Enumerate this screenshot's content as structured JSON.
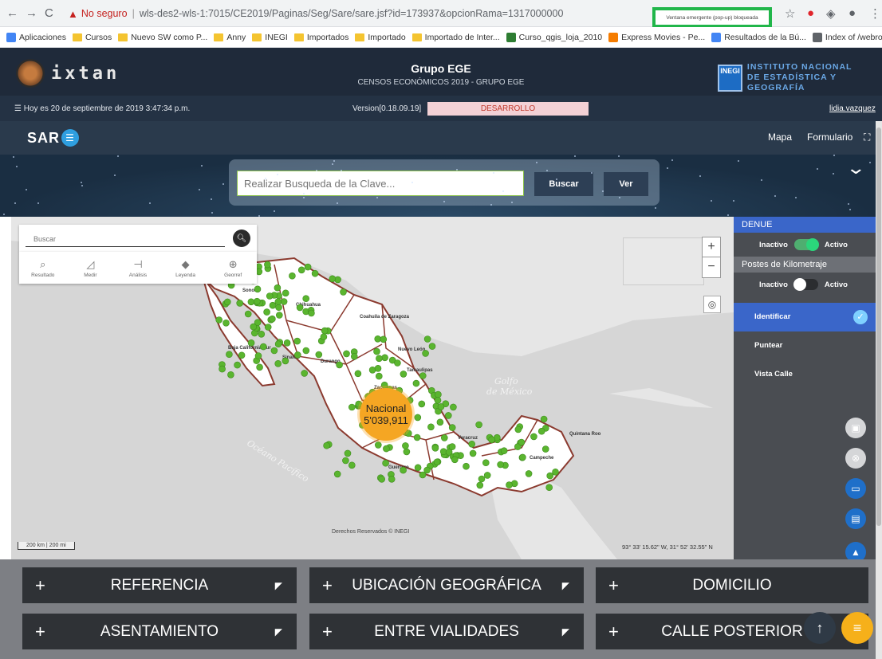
{
  "browser": {
    "security_label": "No seguro",
    "url": "wls-des2-wls-1:7015/CE2019/Paginas/Seg/Sare/sare.jsf?id=173937&opcionRama=1317000000",
    "popup_blocked": "Ventana emergente (pop-up) bloqueada",
    "bookmarks": [
      {
        "label": "Aplicaciones",
        "icon": "apps-grid-icon",
        "color": "#4285f4"
      },
      {
        "label": "Cursos",
        "icon": "folder-icon",
        "color": "#f4c430"
      },
      {
        "label": "Nuevo SW como P...",
        "icon": "folder-icon",
        "color": "#f4c430"
      },
      {
        "label": "Anny",
        "icon": "folder-icon",
        "color": "#f4c430"
      },
      {
        "label": "INEGI",
        "icon": "folder-icon",
        "color": "#f4c430"
      },
      {
        "label": "Importados",
        "icon": "folder-icon",
        "color": "#f4c430"
      },
      {
        "label": "Importado",
        "icon": "folder-icon",
        "color": "#f4c430"
      },
      {
        "label": "Importado de Inter...",
        "icon": "folder-icon",
        "color": "#f4c430"
      },
      {
        "label": "Curso_qgis_loja_2010",
        "icon": "qgis-icon",
        "color": "#2e7d32"
      },
      {
        "label": "Express Movies - Pe...",
        "icon": "blogger-icon",
        "color": "#f57c00"
      },
      {
        "label": "Resultados de la Bú...",
        "icon": "google-icon",
        "color": "#4285f4"
      },
      {
        "label": "Index of /webroot/...",
        "icon": "globe-icon",
        "color": "#5f6368"
      }
    ]
  },
  "header": {
    "logo_text": "ixtan",
    "title": "Grupo EGE",
    "subtitle": "CENSOS ECONÓMICOS 2019 - GRUPO EGE",
    "inegi_badge": "INEGI",
    "inegi_line1": "INSTITUTO NACIONAL",
    "inegi_line2": "DE ESTADÍSTICA Y GEOGRAFÍA",
    "date_text": "Hoy es 20 de septiembre de 2019 3:47:34 p.m.",
    "version": "Version[0.18.09.19]",
    "environment": "DESARROLLO",
    "user": "lidia.vazquez"
  },
  "sare": {
    "logo": "SAR",
    "nav": [
      "Mapa",
      "Formulario"
    ]
  },
  "search": {
    "placeholder": "Realizar Busqueda de la Clave...",
    "buscar": "Buscar",
    "ver": "Ver"
  },
  "map": {
    "search_placeholder": "Buscar",
    "tools": [
      {
        "label": "Resultado",
        "icon": "search-icon"
      },
      {
        "label": "Medir",
        "icon": "ruler-icon"
      },
      {
        "label": "Análisis",
        "icon": "analysis-icon"
      },
      {
        "label": "Leyenda",
        "icon": "tag-icon"
      },
      {
        "label": "Georref",
        "icon": "globe-icon"
      }
    ],
    "cluster_label": "Nacional",
    "cluster_count": "5'039,911",
    "gulf_label_1": "Golfo",
    "gulf_label_2": "de México",
    "ocean_label": "Océano Pacífico",
    "copyright": "Derechos Reservados © INEGI",
    "coordinates": "93° 33' 15.62\" W, 31° 52' 32.55\" N",
    "scale_km": "200 km",
    "scale_mi": "200 mi",
    "state_labels": [
      "Sonora",
      "Chihuahua",
      "Coahuila de Zaragoza",
      "Durango",
      "Sinaloa",
      "Nuevo León",
      "Tamaulipas",
      "Zacatecas",
      "Guerrero",
      "Veracruz",
      "Campeche",
      "Quintana Roo",
      "Baja California Sur"
    ]
  },
  "panel": {
    "denue_title": "DENUE",
    "denue_off": "Inactivo",
    "denue_on": "Activo",
    "postes_title": "Postes de Kilometraje",
    "postes_off": "Inactivo",
    "postes_on": "Activo",
    "items": [
      "Identificar",
      "Puntear",
      "Vista Calle"
    ],
    "accent": "#3a66c9"
  },
  "sections": [
    {
      "label": "REFERENCIA"
    },
    {
      "label": "UBICACIÓN GEOGRÁFICA"
    },
    {
      "label": "DOMICILIO"
    },
    {
      "label": "ASENTAMIENTO"
    },
    {
      "label": "ENTRE VIALIDADES"
    },
    {
      "label": "CALLE POSTERIOR"
    }
  ]
}
